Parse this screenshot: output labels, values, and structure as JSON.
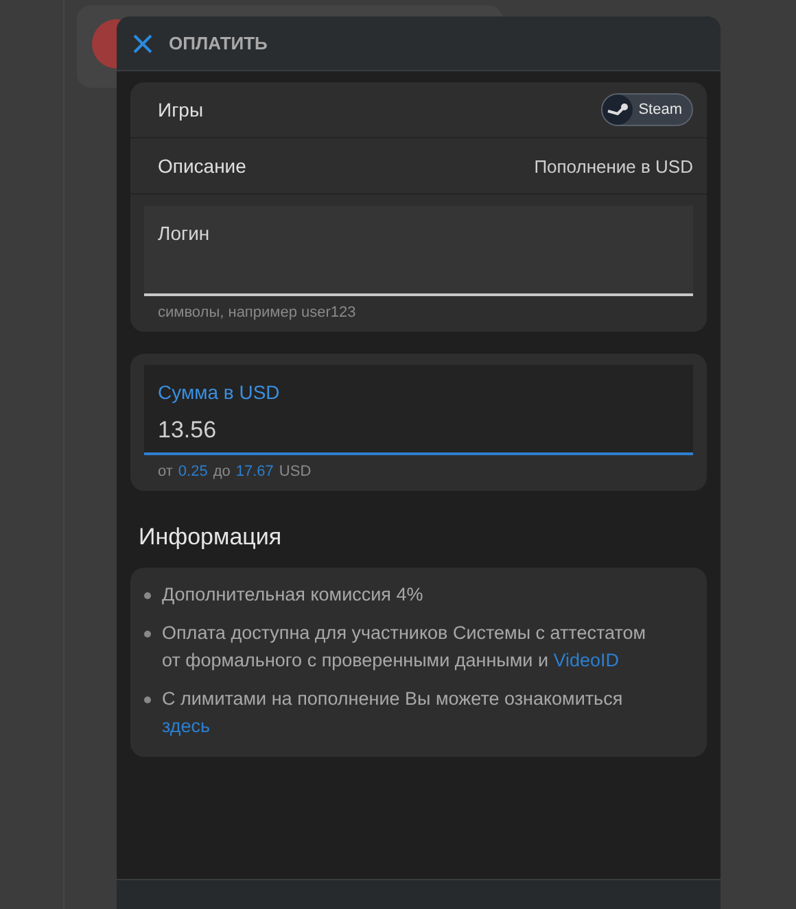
{
  "dialog": {
    "title": "ОПЛАТИТЬ"
  },
  "details": [
    {
      "label": "Игры",
      "kind": "chip",
      "value": "Steam"
    },
    {
      "label": "Описание",
      "kind": "text",
      "value": "Пополнение в USD"
    }
  ],
  "login_field": {
    "label": "Логин",
    "focused": false,
    "hint": "символы, например user123"
  },
  "amount_field": {
    "label": "Сумма в USD",
    "value": "13.56",
    "focused": true,
    "hint_parts": [
      {
        "text": "от",
        "link": false
      },
      {
        "text": "0.25",
        "link": true
      },
      {
        "text": "до",
        "link": false
      },
      {
        "text": "17.67",
        "link": true
      },
      {
        "text": "USD",
        "link": false
      }
    ]
  },
  "info": {
    "title": "Информация",
    "items": [
      {
        "text": "Дополнительная комиссия 4%"
      },
      {
        "text": "Оплата доступна для участников Системы с аттестатом от формального с проверенными данными и",
        "link": "VideoID"
      },
      {
        "text": "С лимитами на пополнение Вы можете ознакомиться",
        "link": "здесь"
      }
    ]
  }
}
